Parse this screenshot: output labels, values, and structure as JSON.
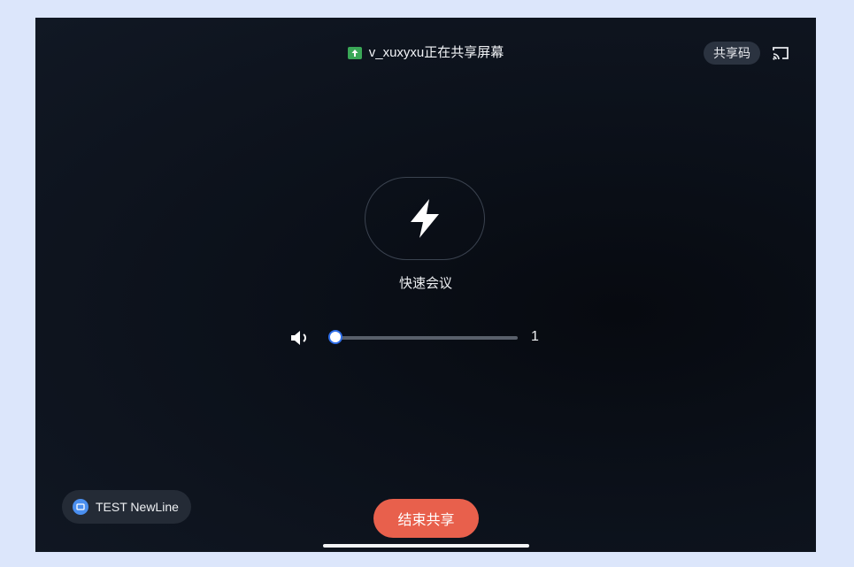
{
  "topbar": {
    "sharing_status": "v_xuxyxu正在共享屏幕",
    "share_code_label": "共享码",
    "status_icon": "screen-share-icon",
    "cast_icon": "cast-icon"
  },
  "quick_meeting": {
    "icon": "lightning-icon",
    "label": "快速会议"
  },
  "volume": {
    "icon": "speaker-icon",
    "value": "1",
    "level_fraction": 0
  },
  "device": {
    "icon": "device-icon",
    "name": "TEST NewLine"
  },
  "end_share": {
    "label": "结束共享"
  },
  "colors": {
    "end_button": "#e8604c",
    "slider_accent": "#2f6ee8",
    "share_icon": "#3aa757"
  }
}
